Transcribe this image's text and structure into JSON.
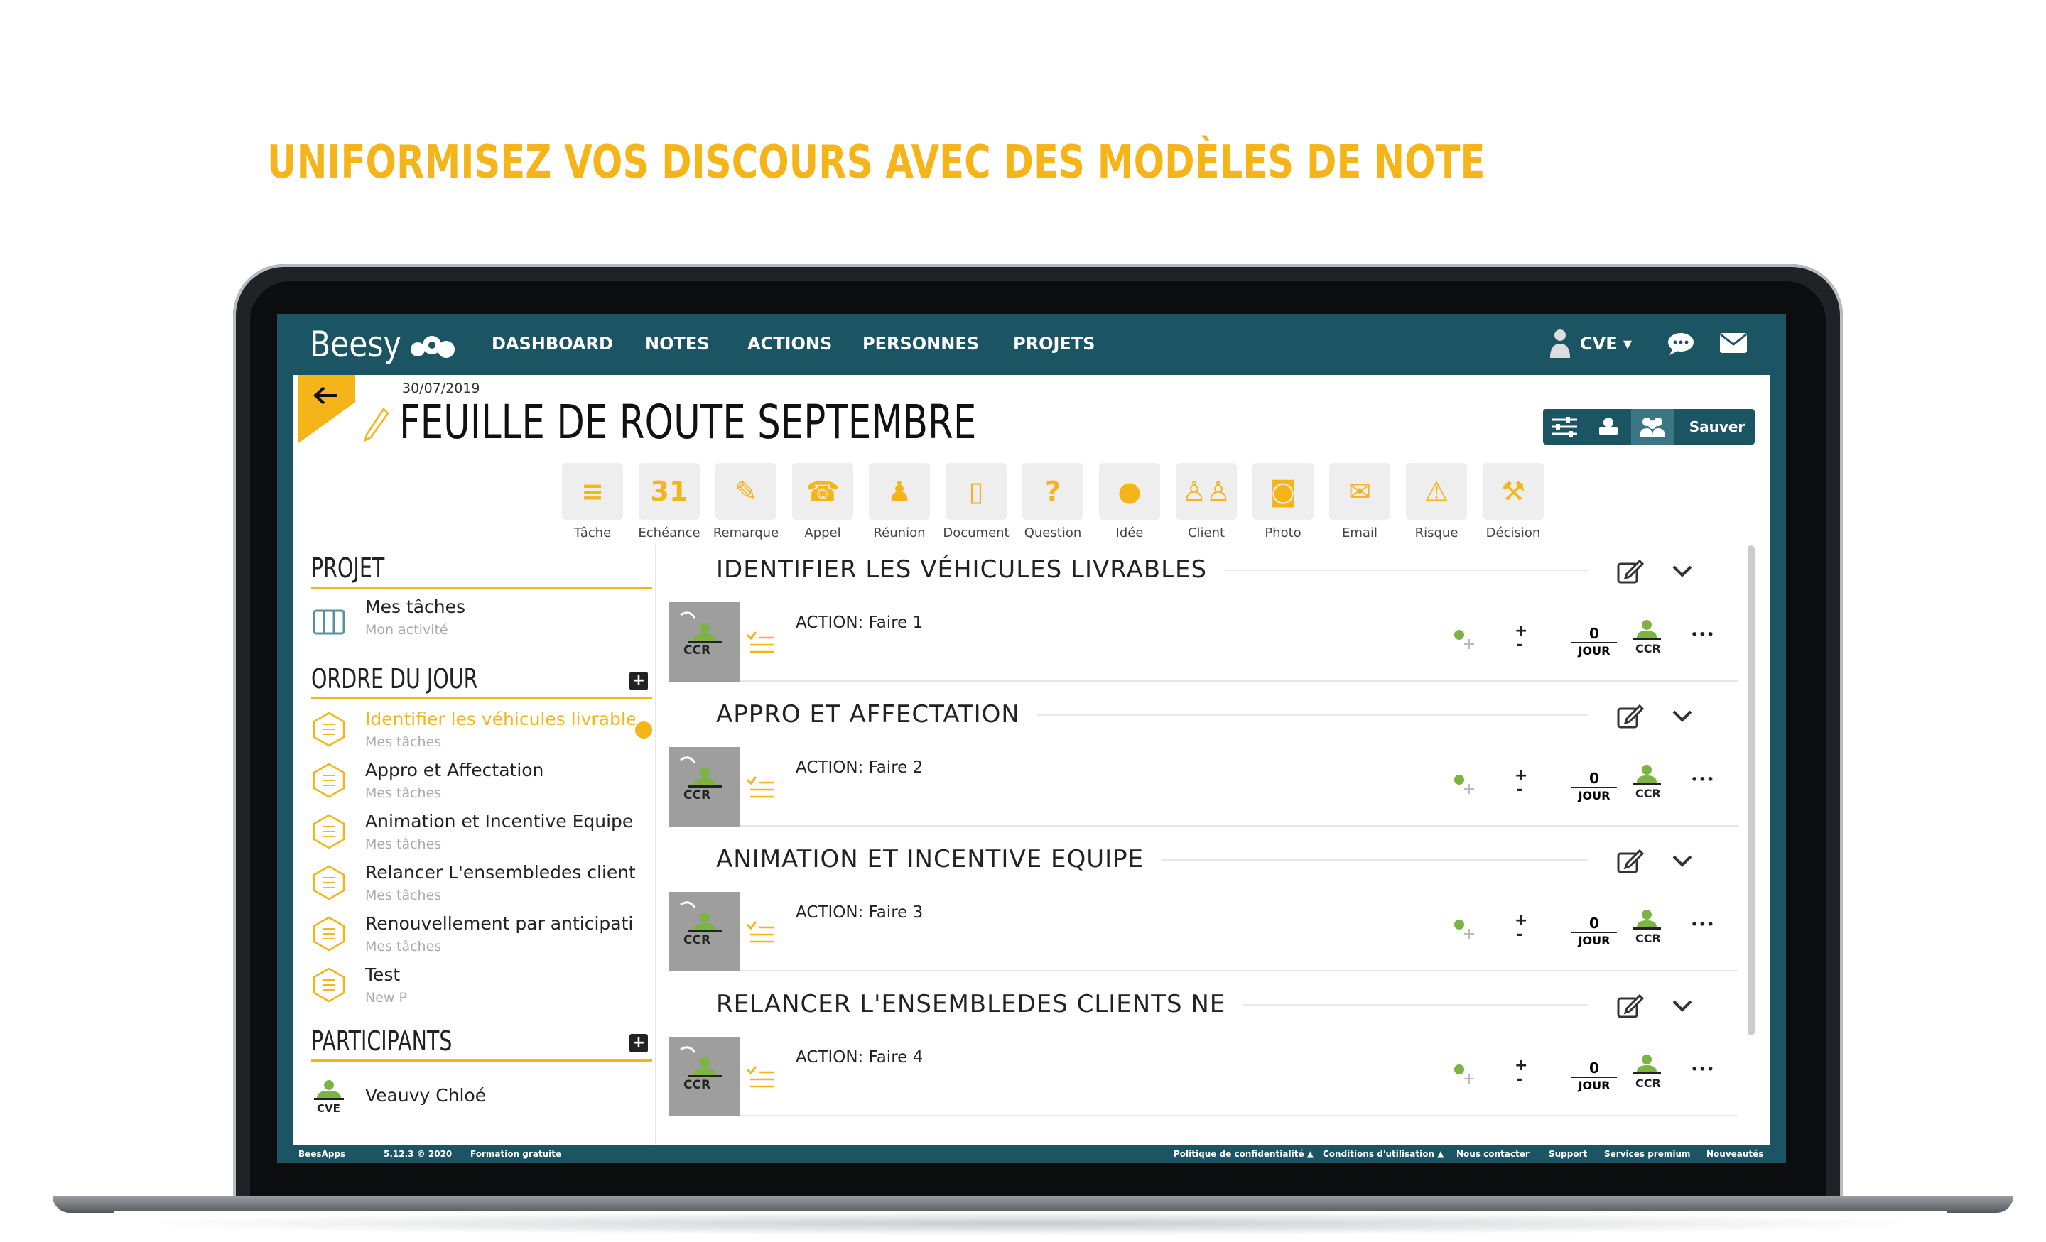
{
  "headline": "UNIFORMISEZ VOS DISCOURS AVEC DES MODÈLES DE NOTE",
  "app": {
    "logo": "Beesy",
    "nav": [
      "DASHBOARD",
      "NOTES",
      "ACTIONS",
      "PERSONNES",
      "PROJETS"
    ],
    "user": "CVE"
  },
  "note": {
    "date": "30/07/2019",
    "title": "FEUILLE DE ROUTE SEPTEMBRE",
    "save_label": "Sauver"
  },
  "tools": [
    "Tâche",
    "Echéance",
    "Remarque",
    "Appel",
    "Réunion",
    "Document",
    "Question",
    "Idée",
    "Client",
    "Photo",
    "Email",
    "Risque",
    "Décision"
  ],
  "tool_glyphs": [
    "≡",
    "31",
    "✎",
    "☎",
    "♟",
    "▯",
    "?",
    "●",
    "♙♙",
    "◙",
    "✉",
    "⚠",
    "⚒"
  ],
  "sidebar": {
    "projet_title": "PROJET",
    "projet_item": {
      "name": "Mes tâches",
      "sub": "Mon activité"
    },
    "odj_title": "ORDRE DU JOUR",
    "odj_items": [
      {
        "name": "Identifier les véhicules livrable",
        "sub": "Mes tâches"
      },
      {
        "name": "Appro et Affectation",
        "sub": "Mes tâches"
      },
      {
        "name": "Animation et Incentive Equipe",
        "sub": "Mes tâches"
      },
      {
        "name": "Relancer L'ensembledes client",
        "sub": "Mes tâches"
      },
      {
        "name": "Renouvellement par anticipati",
        "sub": "Mes tâches"
      },
      {
        "name": "Test",
        "sub": "New P"
      }
    ],
    "participants_title": "PARTICIPANTS",
    "participant": {
      "initials": "CVE",
      "name": "Veauvy Chloé"
    }
  },
  "groups": [
    {
      "title": "IDENTIFIER LES VÉHICULES LIVRABLES",
      "action": "ACTION: Faire 1"
    },
    {
      "title": "APPRO ET AFFECTATION",
      "action": "ACTION: Faire 2"
    },
    {
      "title": "ANIMATION ET INCENTIVE EQUIPE",
      "action": "ACTION: Faire 3"
    },
    {
      "title": "RELANCER L'ENSEMBLEDES CLIENTS NE",
      "action": "ACTION: Faire 4"
    }
  ],
  "row_common": {
    "avatar": "CCR",
    "count": "0",
    "unit": "JOUR",
    "assignee": "CCR",
    "plus": "+",
    "minus": "-",
    "more": "•••"
  },
  "footer": {
    "brand": "BeesApps",
    "version": "5.12.3 © 2020",
    "training": "Formation gratuite",
    "links": [
      "Politique de confidentialité ▲",
      "Conditions d'utilisation ▲",
      "Nous contacter",
      "Support",
      "Services premium",
      "Nouveautés"
    ]
  },
  "colors": {
    "accent": "#f5b418",
    "nav": "#1b5564"
  }
}
